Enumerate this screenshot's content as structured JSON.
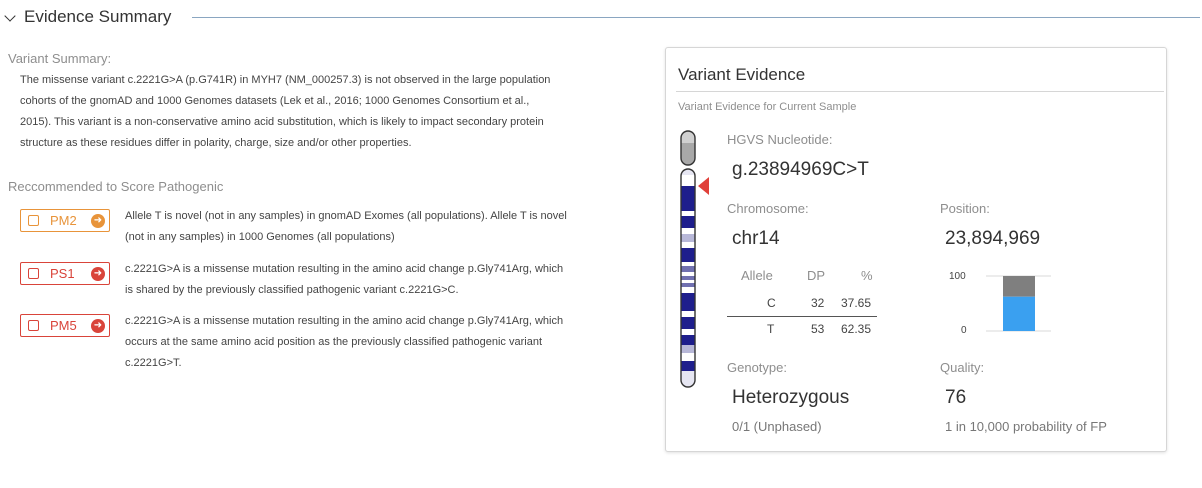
{
  "section": {
    "title": "Evidence Summary"
  },
  "left": {
    "variant_summary_label": "Variant Summary:",
    "variant_summary_lines": [
      "The missense variant c.2221G>A (p.G741R) in MYH7 (NM_000257.3) is not observed in the large population",
      "cohorts of the gnomAD and 1000 Genomes datasets (Lek et al., 2016; 1000 Genomes Consortium et al.,",
      "2015). This variant is a non-conservative amino acid substitution, which is likely to impact secondary protein",
      "structure as these residues differ in polarity, charge, size and/or other properties."
    ],
    "recommended_label": "Reccommended to Score Pathogenic",
    "criteria": [
      {
        "code": "PM2",
        "color": "#e8943a",
        "lines": [
          "Allele T is novel (not in any samples) in gnomAD Exomes (all populations). Allele T is novel",
          "(not in any samples) in 1000 Genomes (all populations)"
        ]
      },
      {
        "code": "PS1",
        "color": "#d9443a",
        "lines": [
          "c.2221G>A is a missense mutation resulting in the amino acid change p.Gly741Arg, which",
          "is shared by the previously classified pathogenic variant c.2221G>C."
        ]
      },
      {
        "code": "PM5",
        "color": "#d9443a",
        "lines": [
          "c.2221G>A is a missense mutation resulting in the amino acid change p.Gly741Arg, which",
          "occurs at the same amino acid position as the previously classified pathogenic variant",
          "c.2221G>T."
        ]
      }
    ]
  },
  "card": {
    "title": "Variant Evidence",
    "subtitle": "Variant Evidence for Current Sample",
    "hgvs_label": "HGVS Nucleotide:",
    "hgvs_value": "g.23894969C>T",
    "chromosome_label": "Chromosome:",
    "chromosome_value": "chr14",
    "position_label": "Position:",
    "position_value": "23,894,969",
    "allele_table": {
      "headers": [
        "Allele",
        "DP",
        "%"
      ],
      "rows": [
        {
          "allele": "C",
          "dp": "32",
          "pct": "37.65"
        },
        {
          "allele": "T",
          "dp": "53",
          "pct": "62.35"
        }
      ]
    },
    "allele_chart": {
      "y_max_label": "100",
      "y_min_label": "0",
      "ref_pct": 37.65,
      "alt_pct": 62.35,
      "ref_color": "#7f7f7f",
      "alt_color": "#3aa0f0"
    },
    "genotype_label": "Genotype:",
    "genotype_value": "Heterozygous",
    "genotype_sub": "0/1 (Unphased)",
    "quality_label": "Quality:",
    "quality_value": "76",
    "quality_sub": "1 in 10,000 probability of FP"
  }
}
